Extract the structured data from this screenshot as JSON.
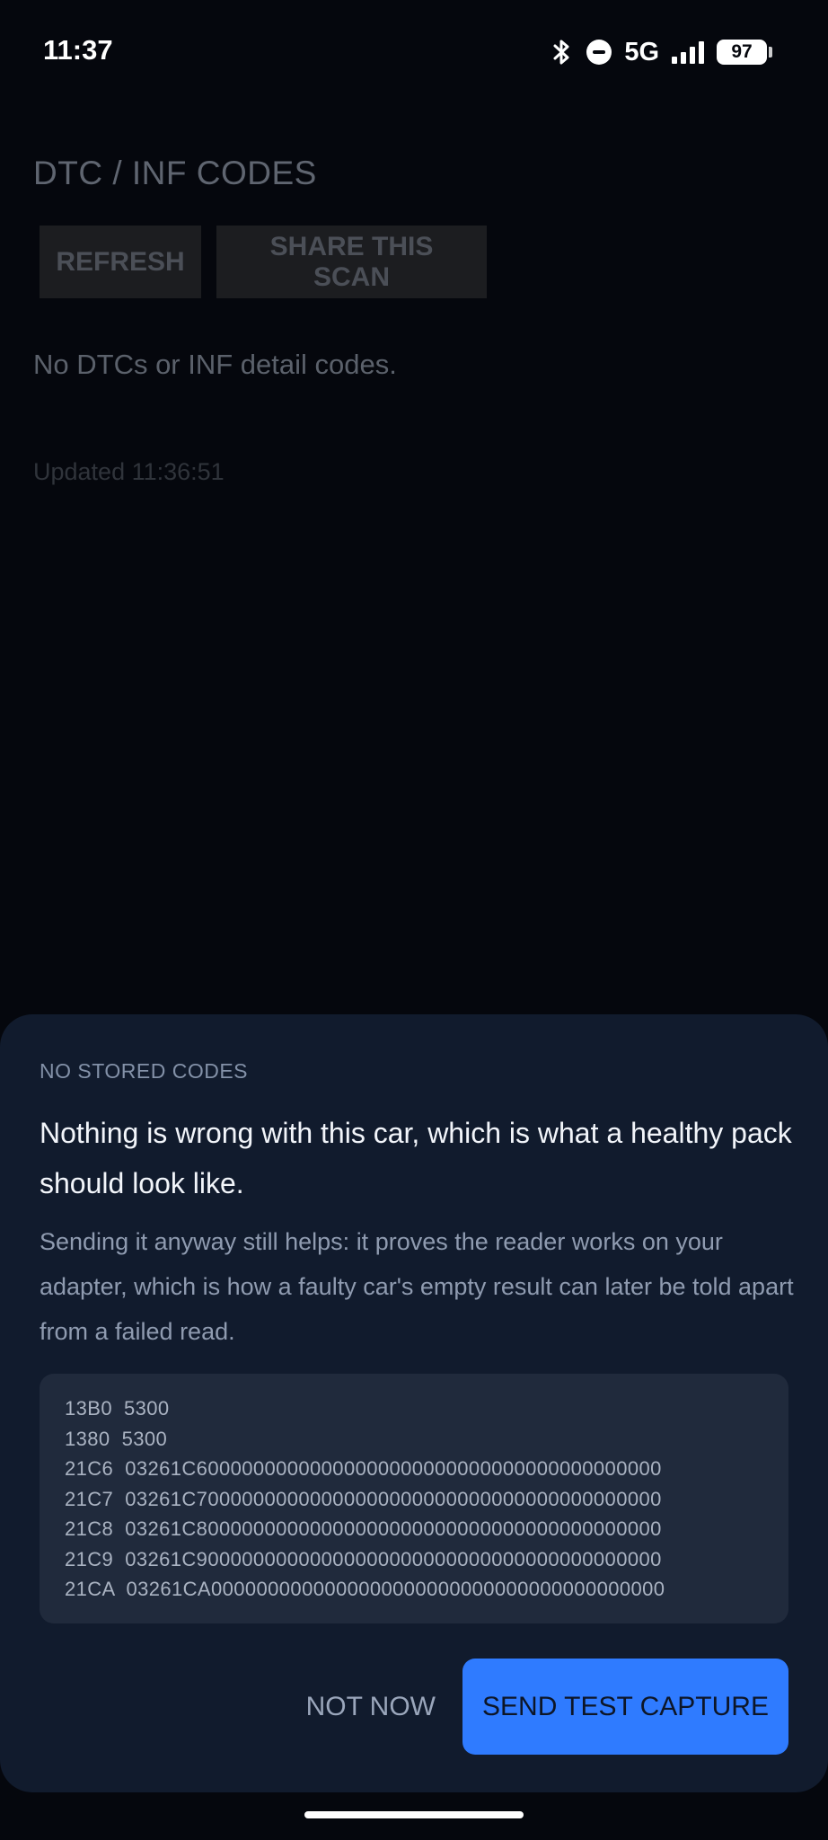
{
  "status_bar": {
    "time": "11:37",
    "network": "5G",
    "battery": "97",
    "icons": [
      "bluetooth-icon",
      "do-not-disturb-icon",
      "signal-icon",
      "battery-icon"
    ]
  },
  "screen": {
    "title": "DTC / INF CODES",
    "refresh_label": "REFRESH",
    "share_label": "SHARE THIS SCAN",
    "empty_message": "No DTCs or INF detail codes.",
    "updated": "Updated 11:36:51"
  },
  "sheet": {
    "eyebrow": "NO STORED CODES",
    "headline": "Nothing is wrong with this car, which is what a healthy pack should look like.",
    "body": "Sending it anyway still helps: it proves the reader works on your adapter, which is how a faulty car's empty result can later be told apart from a failed read.",
    "capture_lines": [
      "13B0  5300",
      "1380  5300",
      "21C6  03261C60000000000000000000000000000000000000000",
      "21C7  03261C70000000000000000000000000000000000000000",
      "21C8  03261C80000000000000000000000000000000000000000",
      "21C9  03261C90000000000000000000000000000000000000000",
      "21CA  03261CA0000000000000000000000000000000000000000"
    ],
    "not_now_label": "NOT NOW",
    "send_label": "SEND TEST CAPTURE"
  },
  "colors": {
    "background": "#05070d",
    "sheet": "#111b2d",
    "accent": "#2f7bff"
  }
}
